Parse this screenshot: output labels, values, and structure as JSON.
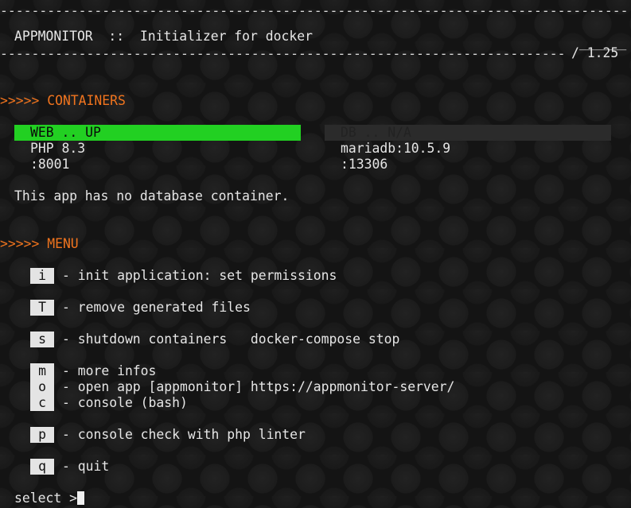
{
  "header": {
    "rule_top": "--------------------------------------------------------------------------------",
    "title": "APPMONITOR  ::  Initializer for docker",
    "version_rule": "______",
    "rule_bottom": "------------------------------------------------------------------------",
    "version": "/ 1.25"
  },
  "containers": {
    "heading": ">>>>> CONTAINERS",
    "web": {
      "status": "WEB .. UP",
      "detail": "PHP 8.3",
      "port": ":8001",
      "color": "#22d022"
    },
    "db": {
      "status": "DB .. N/A",
      "detail": "mariadb:10.5.9",
      "port": ":13306",
      "color": "#2b2b2b"
    },
    "note": "This app has no database container."
  },
  "menu": {
    "heading": ">>>>> MENU",
    "items": [
      {
        "key": "i",
        "text": "- init application: set permissions"
      },
      {
        "key": "T",
        "text": "- remove generated files"
      },
      {
        "key": "s",
        "text": "- shutdown containers   docker-compose stop"
      },
      {
        "key": "m",
        "text": "- more infos"
      },
      {
        "key": "o",
        "text": "- open app [appmonitor] https://appmonitor-server/"
      },
      {
        "key": "c",
        "text": "- console (bash)"
      },
      {
        "key": "p",
        "text": "- console check with php linter"
      },
      {
        "key": "q",
        "text": "- quit"
      }
    ]
  },
  "prompt": {
    "text": "select >"
  },
  "colors": {
    "accent": "#f0741e",
    "background": "#141414"
  }
}
